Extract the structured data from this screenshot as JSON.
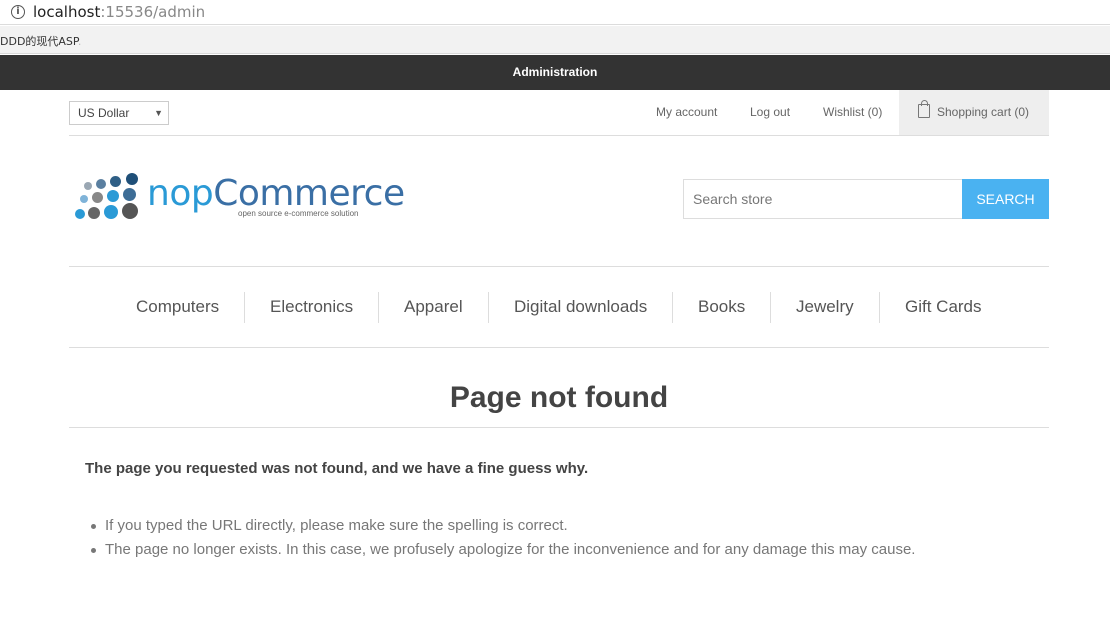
{
  "browser": {
    "url_host": "localhost",
    "url_rest": ":15536/admin",
    "bookmark": "DDD的现代ASP",
    "bookmark_fade": "."
  },
  "admin_bar": {
    "label": "Administration"
  },
  "header": {
    "currency": "US Dollar",
    "links": {
      "my_account": "My account",
      "log_out": "Log out",
      "wishlist": "Wishlist (0)",
      "cart": "Shopping cart (0)"
    }
  },
  "logo": {
    "brand_nop": "nop",
    "brand_commerce": "Commerce",
    "tagline": "open source e-commerce solution"
  },
  "search": {
    "placeholder": "Search store",
    "button": "SEARCH"
  },
  "menu": [
    "Computers",
    "Electronics",
    "Apparel",
    "Digital downloads",
    "Books",
    "Jewelry",
    "Gift Cards"
  ],
  "page": {
    "title": "Page not found",
    "intro": "The page you requested was not found, and we have a fine guess why.",
    "reasons": [
      "If you typed the URL directly, please make sure the spelling is correct.",
      "The page no longer exists. In this case, we profusely apologize for the inconvenience and for any damage this may cause."
    ]
  },
  "colors": {
    "admin_bar": "#333333",
    "search_button": "#4ab2f1",
    "logo_blue": "#2a9ad6",
    "logo_dark_blue": "#3a6fa5"
  }
}
